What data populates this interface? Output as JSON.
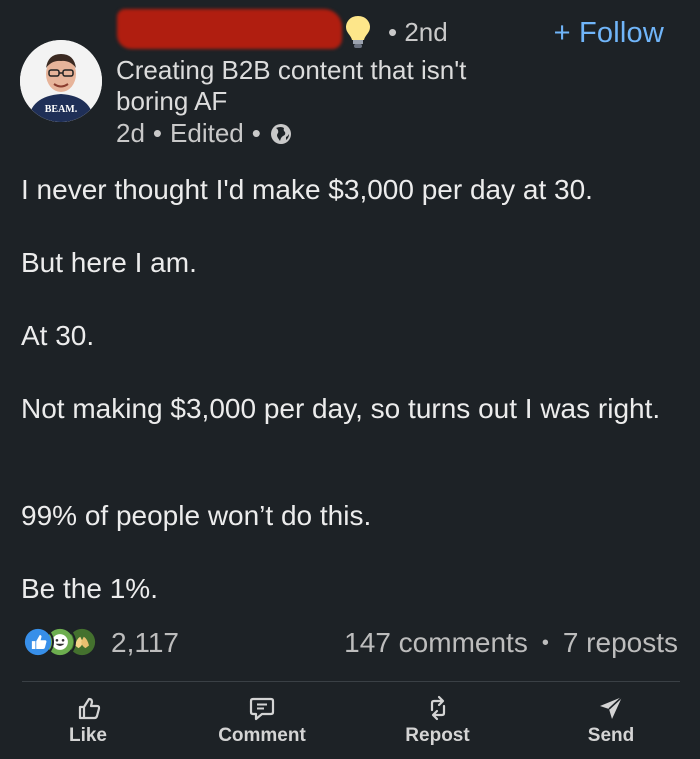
{
  "header": {
    "degree": "• 2nd",
    "follow_label": "+ Follow",
    "headline": "Creating B2B content that isn't boring AF",
    "time": "2d",
    "edited": "Edited",
    "sep": "•",
    "avatar_shirt_text": "BEAM."
  },
  "post": {
    "lines": [
      "I never thought I'd make $3,000 per day at 30.",
      "But here I am.",
      "At 30.",
      "Not making $3,000 per day, so turns out I was right.",
      "99% of people won’t do this.",
      "Be the 1%."
    ]
  },
  "social": {
    "reaction_count": "2,117",
    "comments": "147 comments",
    "sep": "•",
    "reposts": "7 reposts"
  },
  "actions": {
    "like": "Like",
    "comment": "Comment",
    "repost": "Repost",
    "send": "Send"
  },
  "colors": {
    "background": "#1d2226",
    "accent": "#70b5f9",
    "redaction": "#b01e10"
  },
  "icons": [
    "lightbulb-icon",
    "globe-icon",
    "like-reaction-icon",
    "celebrate-reaction-icon",
    "support-reaction-icon",
    "thumbs-up-icon",
    "comment-icon",
    "repost-icon",
    "send-icon"
  ]
}
